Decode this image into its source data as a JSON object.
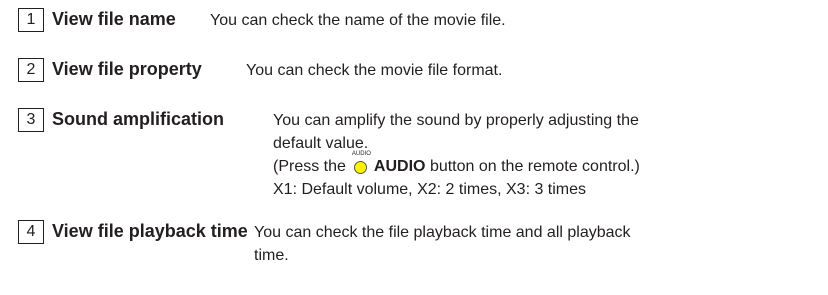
{
  "items": [
    {
      "number": "1",
      "title": "View file name",
      "description": "You can check the name of the movie file."
    },
    {
      "number": "2",
      "title": "View file property",
      "description": "You can check the movie file format."
    },
    {
      "number": "3",
      "title": "Sound amplification",
      "description_line1": "You can amplify the sound by properly adjusting the",
      "description_line2": "default value.",
      "press_prefix": "(Press the",
      "button_icon_label": "AUDIO",
      "button_name": "AUDIO",
      "press_suffix": "button on the remote control.)",
      "levels": "X1: Default volume, X2: 2 times, X3: 3 times"
    },
    {
      "number": "4",
      "title": "View file playback time",
      "description_line1": "You can check the file playback time and all playback",
      "description_line2": "time."
    }
  ],
  "colors": {
    "text": "#231f20",
    "audio_button": "#fff200"
  },
  "icons": {
    "audio_button": "audio-button-icon"
  }
}
